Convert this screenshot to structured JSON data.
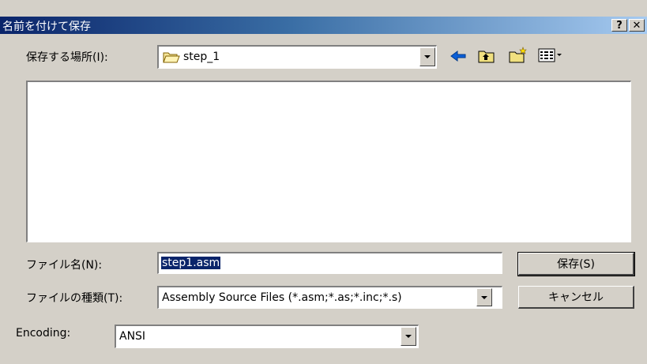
{
  "window": {
    "title": "名前を付けて保存",
    "help_label": "?",
    "close_label": "✕"
  },
  "location": {
    "label": "保存する場所(I):",
    "value": "step_1"
  },
  "filename": {
    "label": "ファイル名(N):",
    "value": "step1.asm"
  },
  "filetype": {
    "label": "ファイルの種類(T):",
    "value": "Assembly Source Files (*.asm;*.as;*.inc;*.s)"
  },
  "encoding": {
    "label": "Encoding:",
    "value": "ANSI"
  },
  "buttons": {
    "save": "保存(S)",
    "cancel": "キャンセル"
  },
  "icons": [
    "folder-icon",
    "back-arrow-icon",
    "up-folder-icon",
    "new-folder-icon",
    "view-menu-icon"
  ]
}
